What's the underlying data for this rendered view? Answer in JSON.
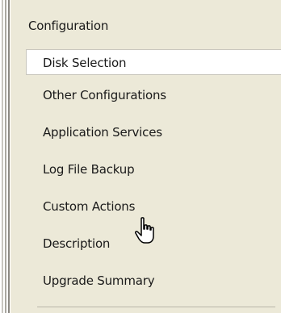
{
  "nav": {
    "section_header": "Configuration",
    "items": [
      {
        "label": "Disk Selection",
        "selected": true
      },
      {
        "label": "Other Configurations"
      },
      {
        "label": "Application Services"
      },
      {
        "label": "Log File Backup"
      },
      {
        "label": "Custom Actions"
      },
      {
        "label": "Description"
      },
      {
        "label": "Upgrade Summary"
      }
    ]
  },
  "cursor": {
    "type": "hand-pointer-icon"
  }
}
